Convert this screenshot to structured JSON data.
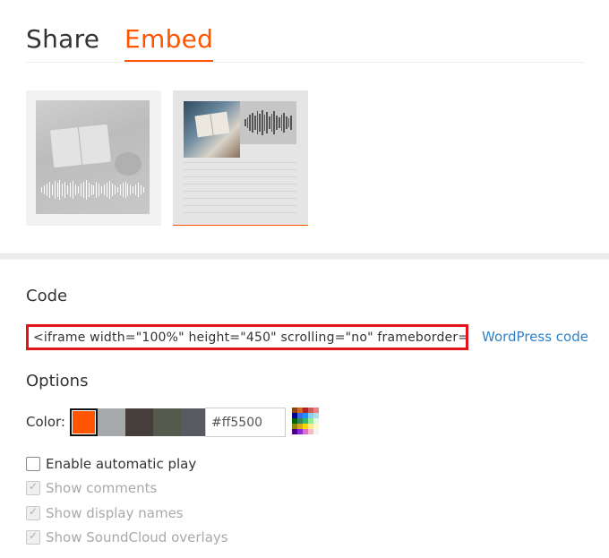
{
  "tabs": {
    "share_label": "Share",
    "embed_label": "Embed"
  },
  "code": {
    "label": "Code",
    "value": "<iframe width=\"100%\" height=\"450\" scrolling=\"no\" frameborder=\"no\"",
    "wordpress_link": "WordPress code"
  },
  "options": {
    "label": "Options",
    "color_label": "Color:",
    "swatches": [
      "#ff5500",
      "#a6a9a9",
      "#463e3a",
      "#555a4c",
      "#595960"
    ],
    "selected_swatch": "#ff5500",
    "hex_value": "#ff5500",
    "palette_icon": "color-palette-icon",
    "checkboxes": [
      {
        "label": "Enable automatic play",
        "checked": false,
        "enabled": true
      },
      {
        "label": "Show comments",
        "checked": true,
        "enabled": false
      },
      {
        "label": "Show display names",
        "checked": true,
        "enabled": false
      },
      {
        "label": "Show SoundCloud overlays",
        "checked": true,
        "enabled": false
      }
    ]
  },
  "colors": {
    "accent": "#ff5500",
    "link": "#3081c8",
    "highlight_border": "#e4141c"
  }
}
